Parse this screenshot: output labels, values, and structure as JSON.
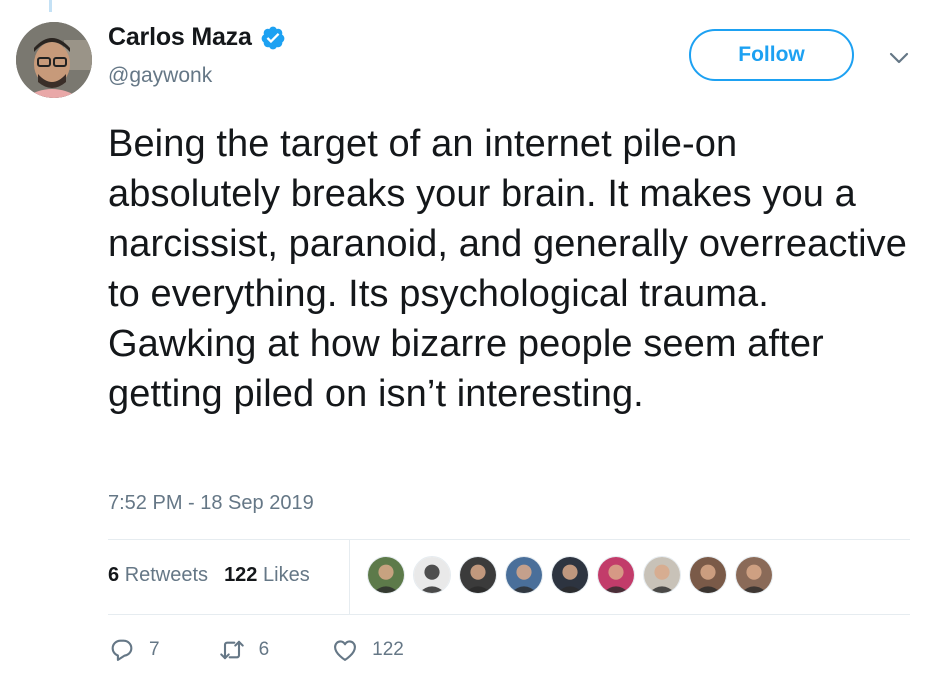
{
  "author": {
    "display_name": "Carlos Maza",
    "handle": "@gaywonk",
    "verified": true
  },
  "follow_button": {
    "label": "Follow"
  },
  "tweet": {
    "text": "Being the target of an internet pile-on absolutely breaks your brain. It makes you a narcissist, paranoid, and generally overreactive to everything. Its psychological trauma. Gawking at how bizarre people seem after getting piled on isn’t interesting.",
    "timestamp": "7:52 PM - 18 Sep 2019"
  },
  "stats": {
    "retweets_count": "6",
    "retweets_label": "Retweets",
    "likes_count": "122",
    "likes_label": "Likes"
  },
  "likers": [
    {
      "color": "#5d7a4a"
    },
    {
      "color": "#e9e9e9"
    },
    {
      "color": "#3b3b3b"
    },
    {
      "color": "#4a6f9a"
    },
    {
      "color": "#2d3440"
    },
    {
      "color": "#c23c6a"
    },
    {
      "color": "#c8c2b8"
    },
    {
      "color": "#7a5a48"
    },
    {
      "color": "#8a6a58"
    }
  ],
  "actions": {
    "reply_count": "7",
    "retweet_count": "6",
    "like_count": "122"
  },
  "colors": {
    "accent": "#1da1f2",
    "secondary_text": "#657786",
    "primary_text": "#14171a",
    "border": "#e6ecf0"
  },
  "icons": {
    "verified": "verified-badge-icon",
    "caret": "chevron-down-icon",
    "reply": "reply-icon",
    "retweet": "retweet-icon",
    "like": "heart-icon"
  }
}
